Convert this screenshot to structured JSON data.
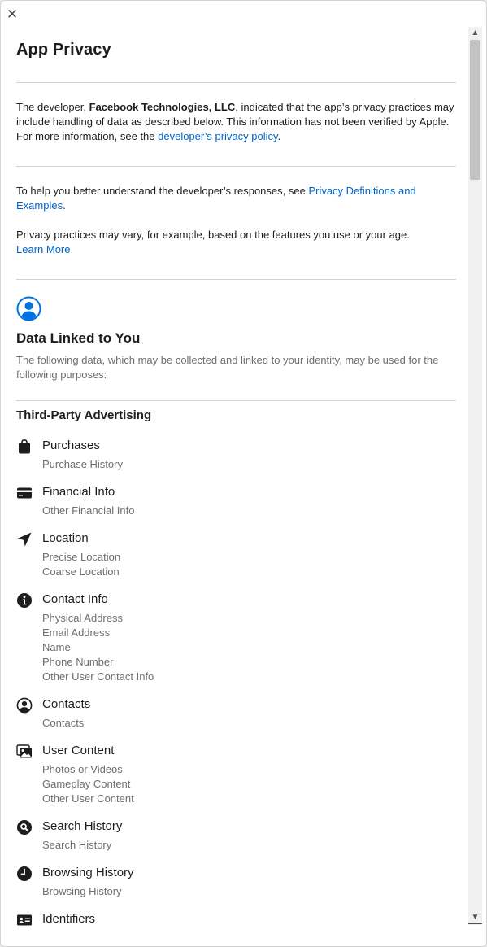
{
  "close_label": "✕",
  "title": "App Privacy",
  "intro": {
    "text_before": "The developer, ",
    "developer_name": "Facebook Technologies, LLC",
    "text_after": ", indicated that the app’s privacy practices may include handling of data as described below. This information has not been verified by Apple. For more information, see the ",
    "policy_link": "developer’s privacy policy",
    "end": "."
  },
  "help": {
    "text": "To help you better understand the developer’s responses, see ",
    "link": "Privacy Definitions and Examples",
    "end": "."
  },
  "vary": {
    "text": "Privacy practices may vary, for example, based on the features you use or your age.",
    "link": "Learn More"
  },
  "section": {
    "title": "Data Linked to You",
    "description": "The following data, which may be collected and linked to your identity, may be used for the following purposes:",
    "purpose": "Third-Party Advertising",
    "categories": [
      {
        "icon": "bag-icon",
        "title": "Purchases",
        "items": [
          "Purchase History"
        ]
      },
      {
        "icon": "credit-card-icon",
        "title": "Financial Info",
        "items": [
          "Other Financial Info"
        ]
      },
      {
        "icon": "location-arrow-icon",
        "title": "Location",
        "items": [
          "Precise Location",
          "Coarse Location"
        ]
      },
      {
        "icon": "info-icon",
        "title": "Contact Info",
        "items": [
          "Physical Address",
          "Email Address",
          "Name",
          "Phone Number",
          "Other User Contact Info"
        ]
      },
      {
        "icon": "person-circle-icon",
        "title": "Contacts",
        "items": [
          "Contacts"
        ]
      },
      {
        "icon": "photos-icon",
        "title": "User Content",
        "items": [
          "Photos or Videos",
          "Gameplay Content",
          "Other User Content"
        ]
      },
      {
        "icon": "magnifier-icon",
        "title": "Search History",
        "items": [
          "Search History"
        ]
      },
      {
        "icon": "clock-icon",
        "title": "Browsing History",
        "items": [
          "Browsing History"
        ]
      },
      {
        "icon": "id-card-icon",
        "title": "Identifiers",
        "items": []
      }
    ]
  },
  "colors": {
    "link": "#0066cc",
    "text": "#1d1d1f",
    "secondary": "#6e6e73",
    "icon_accent": "#0071e3"
  }
}
